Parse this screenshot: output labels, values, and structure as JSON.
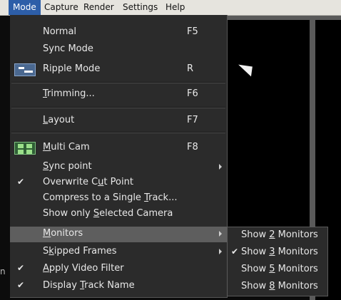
{
  "menubar": {
    "items": [
      {
        "label": "Mode"
      },
      {
        "label": "Capture"
      },
      {
        "label": "Render"
      },
      {
        "label": "Settings"
      },
      {
        "label": "Help"
      }
    ]
  },
  "background": {
    "left_fragment": "n"
  },
  "mode_menu": {
    "items": [
      {
        "label": "Normal",
        "shortcut": "F5"
      },
      {
        "label": "Sync Mode"
      },
      {
        "label": "Ripple Mode",
        "shortcut": "R",
        "icon": "ripple-mode-icon"
      },
      {
        "label_pre": "",
        "label_ul": "T",
        "label_post": "rimming...",
        "shortcut": "F6"
      },
      {
        "label_pre": "",
        "label_ul": "L",
        "label_post": "ayout",
        "shortcut": "F7"
      },
      {
        "label_pre": "",
        "label_ul": "M",
        "label_post": "ulti Cam",
        "shortcut": "F8",
        "icon": "multi-cam-icon"
      },
      {
        "label_pre": "",
        "label_ul": "S",
        "label_post": "ync point",
        "submenu": true
      },
      {
        "label_pre": "Overwrite C",
        "label_ul": "u",
        "label_post": "t Point",
        "checked": true
      },
      {
        "label_pre": "Compress to a Single ",
        "label_ul": "T",
        "label_post": "rack..."
      },
      {
        "label_pre": "Show only ",
        "label_ul": "S",
        "label_post": "elected Camera"
      },
      {
        "label_pre": "",
        "label_ul": "M",
        "label_post": "onitors",
        "submenu": true,
        "highlighted": true
      },
      {
        "label_pre": "S",
        "label_ul": "k",
        "label_post": "ipped Frames",
        "submenu": true
      },
      {
        "label_pre": "",
        "label_ul": "A",
        "label_post": "pply Video Filter",
        "checked": true
      },
      {
        "label_pre": "Display ",
        "label_ul": "T",
        "label_post": "rack Name",
        "checked": true
      }
    ]
  },
  "monitors_submenu": {
    "items": [
      {
        "label_pre": "Show ",
        "label_ul": "2",
        "label_post": " Monitors"
      },
      {
        "label_pre": "Show ",
        "label_ul": "3",
        "label_post": " Monitors",
        "checked": true
      },
      {
        "label_pre": "Show ",
        "label_ul": "5",
        "label_post": " Monitors"
      },
      {
        "label_pre": "Show ",
        "label_ul": "8",
        "label_post": " Monitors"
      }
    ]
  },
  "glyphs": {
    "check": "✔"
  }
}
